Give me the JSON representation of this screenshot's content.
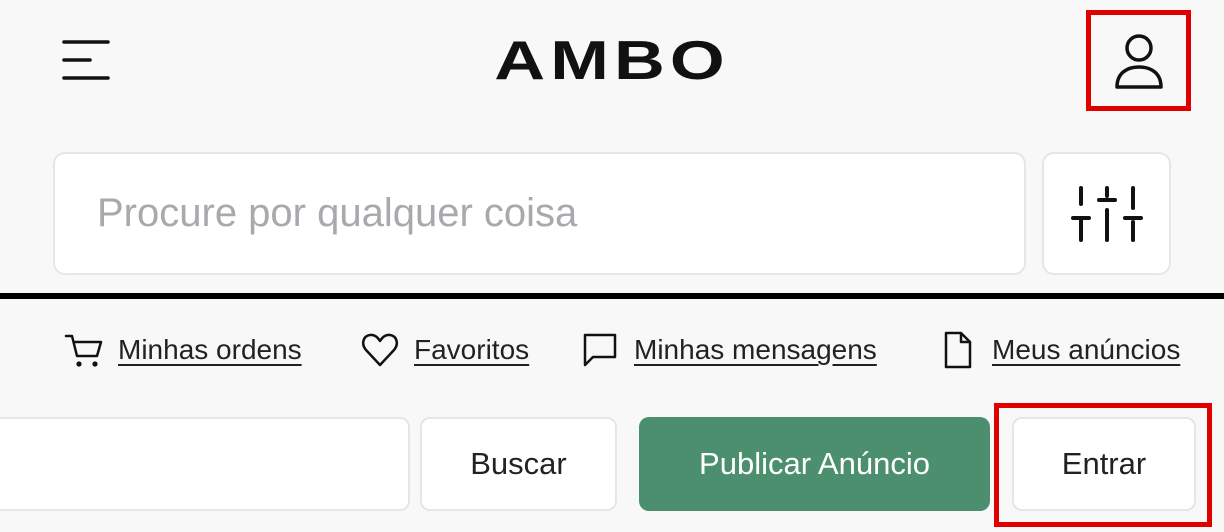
{
  "header": {
    "brand": "AMBO",
    "menu_icon": "hamburger-menu-icon",
    "user_icon": "user-icon",
    "highlight_color": "#e10000"
  },
  "search": {
    "placeholder": "Procure por qualquer coisa",
    "value": "",
    "filter_icon": "sliders-filter-icon"
  },
  "nav_links": [
    {
      "label": "Minhas ordens",
      "icon": "cart-icon"
    },
    {
      "label": "Favoritos",
      "icon": "heart-icon"
    },
    {
      "label": "Minhas mensagens",
      "icon": "message-icon"
    },
    {
      "label": "Meus anúncios",
      "icon": "document-icon"
    }
  ],
  "actions": {
    "search_value": "",
    "buscar_label": "Buscar",
    "publicar_label": "Publicar Anúncio",
    "entrar_label": "Entrar",
    "publicar_color": "#4c8f6f"
  }
}
